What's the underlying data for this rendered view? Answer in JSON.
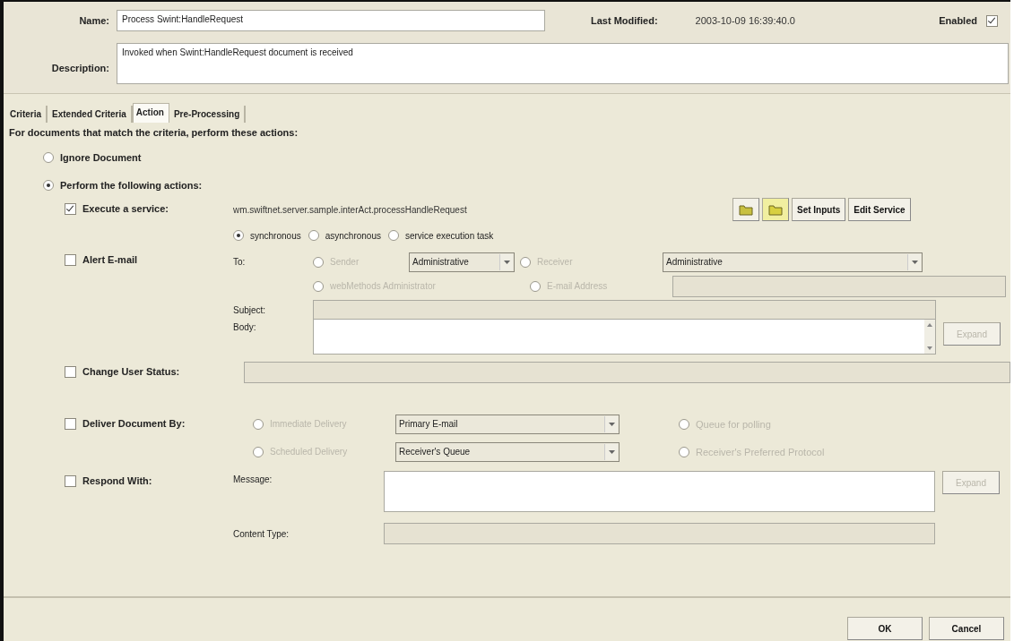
{
  "header": {
    "name_label": "Name:",
    "name_value": "Process Swint:HandleRequest",
    "modified_label": "Last Modified:",
    "modified_value": "2003-10-09 16:39:40.0",
    "enabled_label": "Enabled",
    "enabled_checked": true,
    "description_label": "Description:",
    "description_value": "Invoked when Swint:HandleRequest document is received"
  },
  "tabs": [
    {
      "label": "Criteria",
      "selected": false
    },
    {
      "label": "Extended Criteria",
      "selected": false
    },
    {
      "label": "Action",
      "selected": true
    },
    {
      "label": "Pre-Processing",
      "selected": false
    }
  ],
  "intro": "For documents that match the criteria, perform these actions:",
  "mode_options": [
    {
      "label": "Ignore Document",
      "selected": false
    },
    {
      "label": "Perform the following actions:",
      "selected": true
    }
  ],
  "execute": {
    "label": "Execute a service:",
    "checked": true,
    "service": "wm.swiftnet.server.sample.interAct.processHandleRequest",
    "buttons": [
      "Set Inputs",
      "Edit Service"
    ],
    "modes": [
      {
        "label": "synchronous",
        "selected": true
      },
      {
        "label": "asynchronous",
        "selected": false
      },
      {
        "label": "service execution task",
        "selected": false
      }
    ]
  },
  "alert": {
    "label": "Alert E-mail",
    "checked": false,
    "to_label": "To:",
    "recipients": [
      {
        "label": "Sender",
        "selected": false,
        "disabled": true,
        "select": "Administrative"
      },
      {
        "label": "Receiver",
        "selected": false,
        "disabled": true,
        "select": "Administrative"
      },
      {
        "label": "webMethods Administrator",
        "selected": false,
        "disabled": true
      },
      {
        "label": "E-mail Address",
        "selected": false,
        "disabled": true
      }
    ],
    "subject_label": "Subject:",
    "body_label": "Body:",
    "expand": {
      "label": "Expand",
      "disabled": true
    }
  },
  "user_status": {
    "label": "Change User Status:",
    "checked": false
  },
  "deliver": {
    "label": "Deliver Document By:",
    "checked": false,
    "options": [
      {
        "label": "Immediate Delivery",
        "selected": false,
        "disabled": true,
        "select": "Primary E-mail"
      },
      {
        "label": "Queue for polling",
        "selected": false,
        "disabled": true
      },
      {
        "label": "Scheduled Delivery",
        "selected": false,
        "disabled": true,
        "select": "Receiver's Queue"
      },
      {
        "label": "Receiver's Preferred Protocol",
        "selected": false,
        "disabled": true
      }
    ]
  },
  "respond": {
    "label": "Respond With:",
    "checked": false,
    "message_label": "Message:",
    "content_type_label": "Content Type:",
    "expand": {
      "label": "Expand",
      "disabled": true
    }
  },
  "footer_buttons": [
    "OK",
    "Cancel"
  ]
}
